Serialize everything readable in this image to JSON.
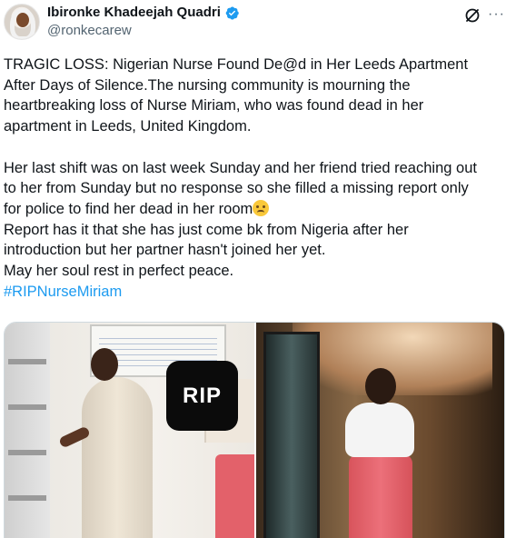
{
  "author": {
    "name": "Ibironke Khadeejah Quadri",
    "handle": "@ronkecarew",
    "verified_color": "#1d9bf0"
  },
  "header_icons": [
    "grok-icon",
    "more-icon"
  ],
  "more_glyph": "···",
  "tweet": {
    "line1": "TRAGIC LOSS: Nigerian Nurse Found De@d in Her Leeds Apartment",
    "line2": "After Days of Silence.The nursing community is mourning the",
    "line3": "heartbreaking loss of Nurse Miriam, who was found dead in her",
    "line4": "apartment in Leeds, United Kingdom.",
    "line5": "Her last shift was on last week Sunday and her friend tried reaching out",
    "line6": "to her from Sunday but no response so she filled a missing report only",
    "line7": "for police to find her dead in her room",
    "line8": "Report has it that she has just come bk from Nigeria after her",
    "line9": "introduction but her partner hasn't joined her yet.",
    "line10": "May her soul rest in perfect peace.",
    "hashtag": "#RIPNurseMiriam"
  },
  "media": {
    "badge_text": "RIP",
    "photos": [
      "photo-left",
      "photo-right"
    ]
  },
  "colors": {
    "text": "#0f1419",
    "secondary": "#536471",
    "link": "#1d9bf0",
    "border": "#cfd9de"
  }
}
